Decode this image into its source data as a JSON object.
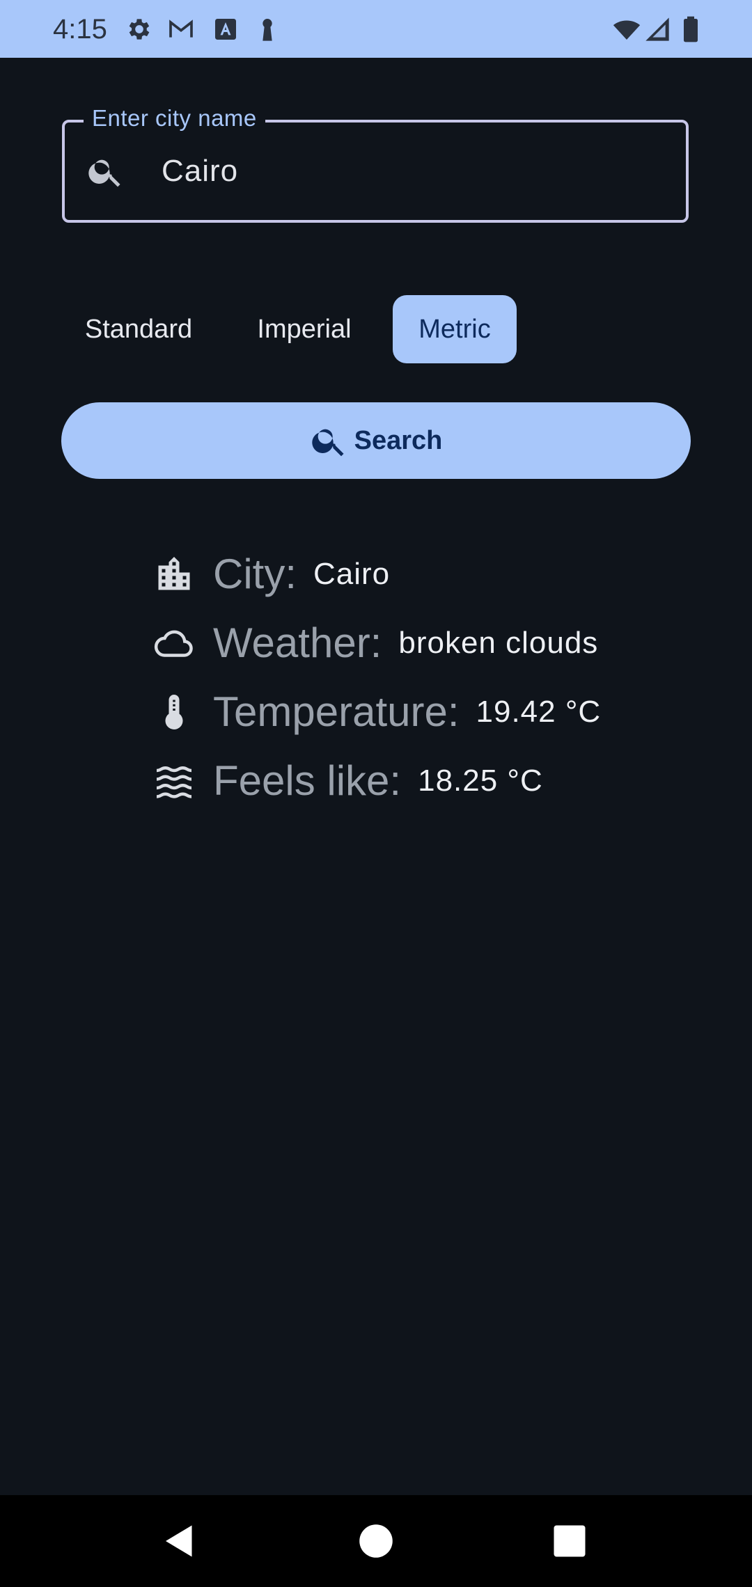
{
  "status_bar": {
    "time": "4:15",
    "icons": [
      "gear-icon",
      "gmail-icon",
      "font-a-icon",
      "keyhole-icon",
      "wifi-icon",
      "signal-icon",
      "battery-icon"
    ],
    "background_color": "#a8c7fa"
  },
  "city_field": {
    "label": "Enter city name",
    "value": "Cairo",
    "icon": "search-icon"
  },
  "units": {
    "options": [
      "Standard",
      "Imperial",
      "Metric"
    ],
    "selected": "Metric"
  },
  "search_button": {
    "label": "Search",
    "icon": "search-icon"
  },
  "results": {
    "city": {
      "label": "City:",
      "value": "Cairo",
      "icon": "building-icon"
    },
    "weather": {
      "label": "Weather:",
      "value": "broken clouds",
      "icon": "cloud-icon"
    },
    "temperature": {
      "label": "Temperature:",
      "value": "19.42 °C",
      "icon": "thermometer-icon"
    },
    "feels_like": {
      "label": "Feels like:",
      "value": "18.25 °C",
      "icon": "waves-icon"
    }
  },
  "nav_bar": {
    "buttons": [
      "back-icon",
      "home-icon",
      "recents-icon"
    ]
  },
  "colors": {
    "background": "#0f141b",
    "accent": "#a8c7fa",
    "on_accent": "#0d2a5c",
    "label_gray": "#9aa1ab"
  }
}
